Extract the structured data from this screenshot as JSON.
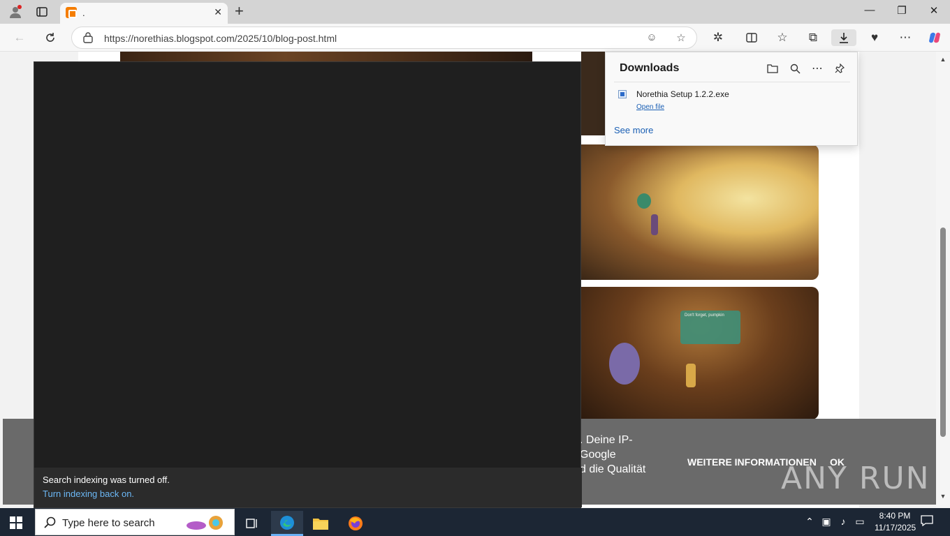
{
  "browser": {
    "tab_title": ".",
    "url": "https://norethias.blogspot.com/2025/10/blog-post.html"
  },
  "downloads": {
    "title": "Downloads",
    "file_name": "Norethia Setup 1.2.2.exe",
    "open_file": "Open file",
    "see_more": "See more"
  },
  "search_panel": {
    "message": "Search indexing was turned off.",
    "link": "Turn indexing back on."
  },
  "game_ui": {
    "menu_title": "Don't forget, pumpkin"
  },
  "cookie_banner": {
    "text_line1": ". Deine IP-",
    "text_line2": "Google",
    "text_line3": "d die Qualität",
    "more_info": "WEITERE INFORMATIONEN",
    "ok": "OK"
  },
  "taskbar": {
    "search_placeholder": "Type here to search",
    "time": "8:40 PM",
    "date": "11/17/2025"
  },
  "watermark": "ANY RUN",
  "colors": {
    "taskbar": "#1c2634",
    "search_panel": "#1f1f1f",
    "link": "#1a5fb4",
    "accent": "#6ab0f5"
  }
}
